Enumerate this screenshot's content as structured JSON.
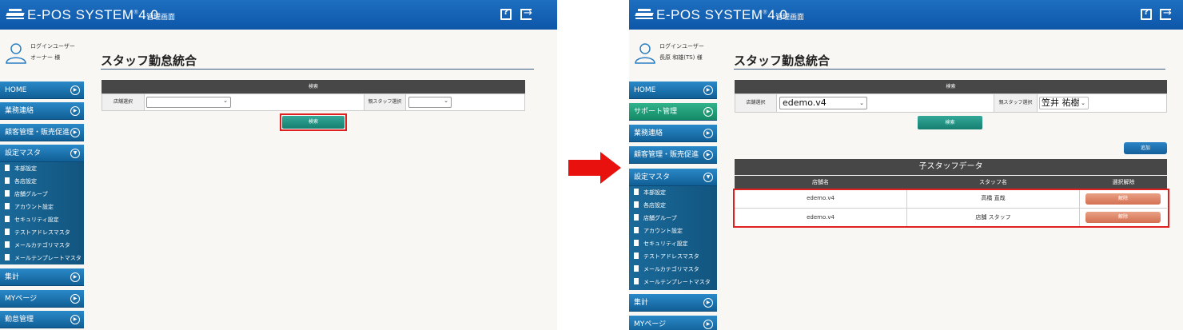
{
  "header": {
    "brand": "E-POS SYSTEM",
    "version": "4.0",
    "subtitle": "管理画面",
    "help_icon": "help-book-icon",
    "logout_icon": "logout-icon"
  },
  "colors": {
    "header_blue": "#1565b4",
    "nav_blue": "#1d74b0",
    "support_green": "#1f9a74",
    "teal_button": "#1f8f7f",
    "release_button": "#d9785a",
    "highlight_red": "#e02020",
    "arrow_red": "#e8110d"
  },
  "before": {
    "user": {
      "label": "ログインユーザー",
      "name": "オーナー 様"
    },
    "nav": [
      {
        "label": "HOME"
      },
      {
        "label": "業務連絡"
      },
      {
        "label": "顧客管理・販売促進"
      },
      {
        "label": "設定マスタ"
      },
      {
        "label": "集計"
      },
      {
        "label": "MYページ"
      },
      {
        "label": "勤怠管理"
      }
    ],
    "settings_sub": [
      "本部設定",
      "各店設定",
      "店舗グループ",
      "アカウント設定",
      "セキュリティ設定",
      "テストアドレスマスタ",
      "メールカテゴリマスタ",
      "メールテンプレートマスタ"
    ],
    "page_title": "スタッフ勤怠統合",
    "search": {
      "header": "検索",
      "store_label": "店舗選択",
      "store_value": "",
      "parent_label": "親スタッフ選択",
      "parent_value": "",
      "button": "検索"
    }
  },
  "after": {
    "user": {
      "label": "ログインユーザー",
      "name": "長原 和雄(TS) 様"
    },
    "nav": [
      {
        "label": "HOME"
      },
      {
        "label": "サポート管理"
      },
      {
        "label": "業務連絡"
      },
      {
        "label": "顧客管理・販売促進"
      },
      {
        "label": "設定マスタ"
      },
      {
        "label": "集計"
      },
      {
        "label": "MYページ"
      }
    ],
    "settings_sub": [
      "本部設定",
      "各店設定",
      "店舗グループ",
      "アカウント設定",
      "セキュリティ設定",
      "テストアドレスマスタ",
      "メールカテゴリマスタ",
      "メールテンプレートマスタ"
    ],
    "page_title": "スタッフ勤怠統合",
    "search": {
      "header": "検索",
      "store_label": "店舗選択",
      "store_value": "edemo.v4",
      "parent_label": "親スタッフ選択",
      "parent_value": "笠井 祐樹",
      "button": "検索"
    },
    "add_button": "追加",
    "child_table": {
      "title": "子スタッフデータ",
      "columns": [
        "店舗名",
        "スタッフ名",
        "選択解除"
      ],
      "rows": [
        {
          "store": "edemo.v4",
          "staff": "高橋 直哉",
          "action": "解除"
        },
        {
          "store": "edemo.v4",
          "staff": "店舗 スタッフ",
          "action": "解除"
        }
      ]
    }
  }
}
